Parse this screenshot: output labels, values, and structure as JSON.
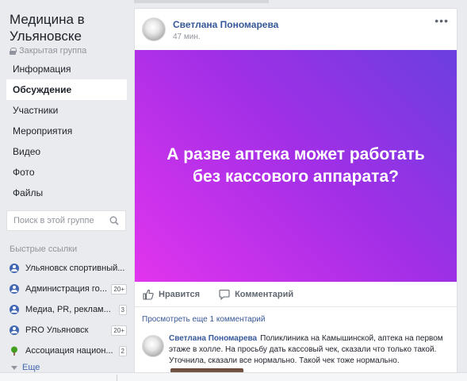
{
  "group": {
    "title": "Медицина в Ульяновске",
    "privacy": "Закрытая группа"
  },
  "nav": [
    {
      "label": "Информация"
    },
    {
      "label": "Обсуждение"
    },
    {
      "label": "Участники"
    },
    {
      "label": "Мероприятия"
    },
    {
      "label": "Видео"
    },
    {
      "label": "Фото"
    },
    {
      "label": "Файлы"
    }
  ],
  "search": {
    "placeholder": "Поиск в этой группе"
  },
  "quick_links": {
    "title": "Быстрые ссылки",
    "items": [
      {
        "label": "Ульяновск спортивный...",
        "badge": ""
      },
      {
        "label": "Администрация го...",
        "badge": "20+"
      },
      {
        "label": "Медиа, PR, реклам...",
        "badge": "3"
      },
      {
        "label": "PRO Ульяновск",
        "badge": "20+"
      },
      {
        "label": "Ассоциация национ...",
        "badge": "2"
      }
    ],
    "more_label": "Еще"
  },
  "post": {
    "author": "Светлана Пономарева",
    "time": "47 мин.",
    "banner_text": "А разве аптека может работать без кассового аппарата?",
    "like_label": "Нравится",
    "comment_label": "Комментарий",
    "view_more": "Просмотреть еще 1 комментарий",
    "comment": {
      "author": "Светлана Пономарева",
      "text": "Поликлиника на Камышинской, аптека на первом этаже в холле. На просьбу дать кассовый чек, сказали что только такой. Уточнила, сказали все нормально. Такой чек тоже нормально."
    }
  },
  "colors": {
    "link": "#365899",
    "banner_start": "#e234ee",
    "banner_end": "#6b3fe0",
    "background": "#e9ebee"
  }
}
